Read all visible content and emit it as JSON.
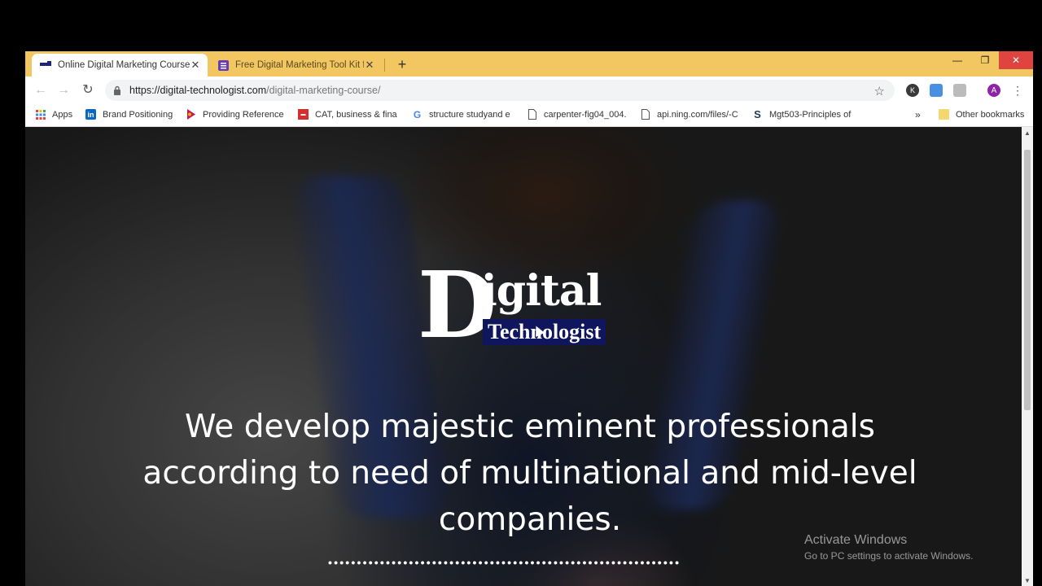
{
  "tabs": [
    {
      "title": "Online Digital Marketing Course",
      "active": true
    },
    {
      "title": "Free Digital Marketing Tool Kit fo",
      "active": false
    }
  ],
  "toolbar": {
    "url_host": "https://digital-technologist.com",
    "url_path": "/digital-marketing-course/",
    "profile_initial": "A",
    "ext_initial": "K"
  },
  "bookmarks": [
    {
      "label": "Apps",
      "icon": "apps-grid-icon"
    },
    {
      "label": "Brand Positioning",
      "icon": "linkedin-icon"
    },
    {
      "label": "Providing Reference",
      "icon": "slides-icon"
    },
    {
      "label": "CAT, business & fina",
      "icon": "site-icon"
    },
    {
      "label": "structure studyand e",
      "icon": "google-icon"
    },
    {
      "label": "carpenter-fig04_004.",
      "icon": "document-icon"
    },
    {
      "label": "api.ning.com/files/-C",
      "icon": "document-icon"
    },
    {
      "label": "Mgt503-Principles of",
      "icon": "scribd-icon"
    }
  ],
  "bookmarks_overflow": "»",
  "other_bookmarks": "Other bookmarks",
  "page": {
    "logo_d": "D",
    "logo_igital": "igital",
    "logo_tech": "Technologist",
    "headline": "We develop majestic eminent professionals according to need of multinational and mid-level companies.",
    "dots": "•••••••••••••••••••••••••••••••••••••••••••••••••••••••••••••"
  },
  "watermark": {
    "line1": "Activate Windows",
    "line2": "Go to PC settings to activate Windows."
  },
  "colors": {
    "tabstrip": "#f2c661",
    "logo_banner": "#10165e",
    "close_button": "#e0443e"
  }
}
